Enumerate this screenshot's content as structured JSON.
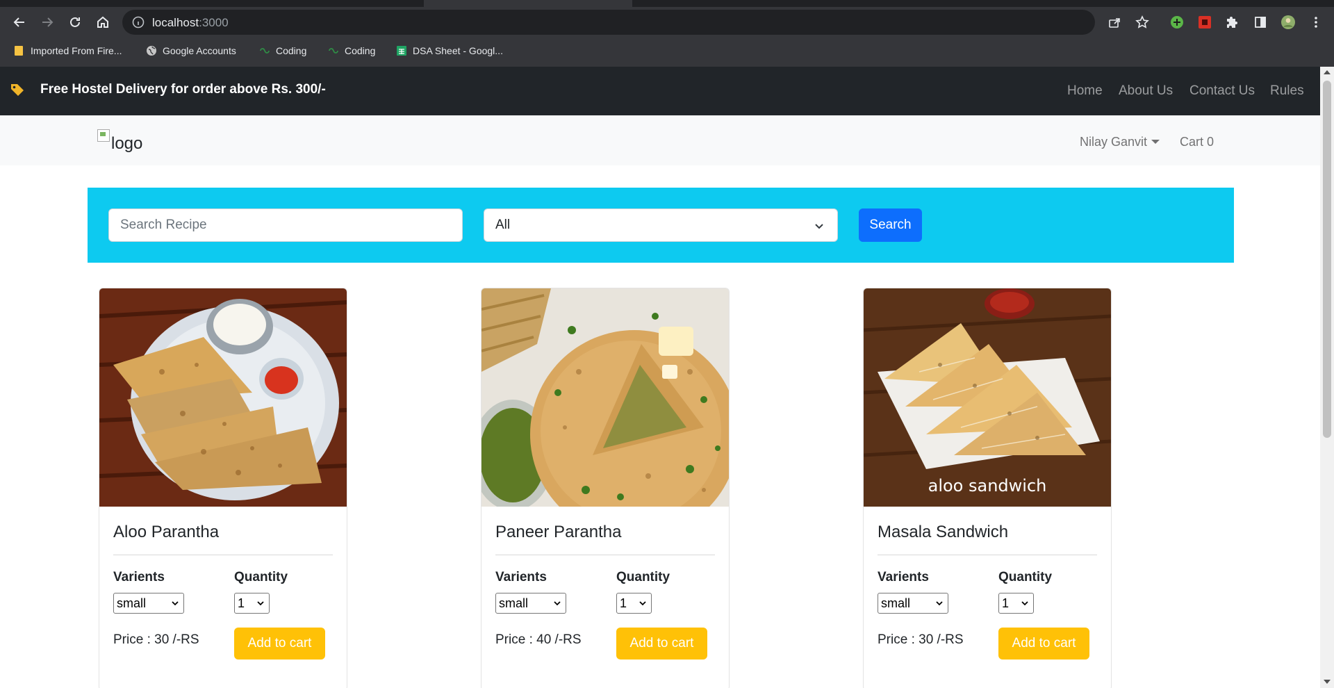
{
  "browser": {
    "url_host": "localhost",
    "url_port": ":3000",
    "bookmarks": [
      {
        "label": "Imported From Fire...",
        "icon": "folder-icon"
      },
      {
        "label": "Google Accounts",
        "icon": "globe-icon"
      },
      {
        "label": "Coding",
        "icon": "gfg-icon"
      },
      {
        "label": "Coding",
        "icon": "gfg-icon"
      },
      {
        "label": "DSA Sheet - Googl...",
        "icon": "sheets-icon"
      }
    ]
  },
  "topbar": {
    "promo_text": "Free Hostel Delivery for order above Rs. 300/-",
    "links": [
      "Home",
      "About Us",
      "Contact Us",
      "Rules"
    ]
  },
  "navbar": {
    "logo_alt": "logo",
    "user_name": "Nilay Ganvit",
    "cart_label": "Cart",
    "cart_count": "0"
  },
  "search": {
    "placeholder": "Search Recipe",
    "category_selected": "All",
    "button_label": "Search"
  },
  "labels": {
    "variants": "Varients",
    "quantity": "Quantity",
    "add_to_cart": "Add to cart"
  },
  "products": [
    {
      "name": "Aloo Parantha",
      "variant": "small",
      "quantity": "1",
      "price": "Price : 30 /-RS"
    },
    {
      "name": "Paneer Parantha",
      "variant": "small",
      "quantity": "1",
      "price": "Price : 40 /-RS"
    },
    {
      "name": "Masala Sandwich",
      "variant": "small",
      "quantity": "1",
      "price": "Price : 30 /-RS",
      "image_caption": "aloo sandwich"
    }
  ],
  "colors": {
    "topbar_bg": "#212529",
    "search_panel_bg": "#0dcaf0",
    "primary_button": "#0d6efd",
    "warning_button": "#ffc107"
  }
}
